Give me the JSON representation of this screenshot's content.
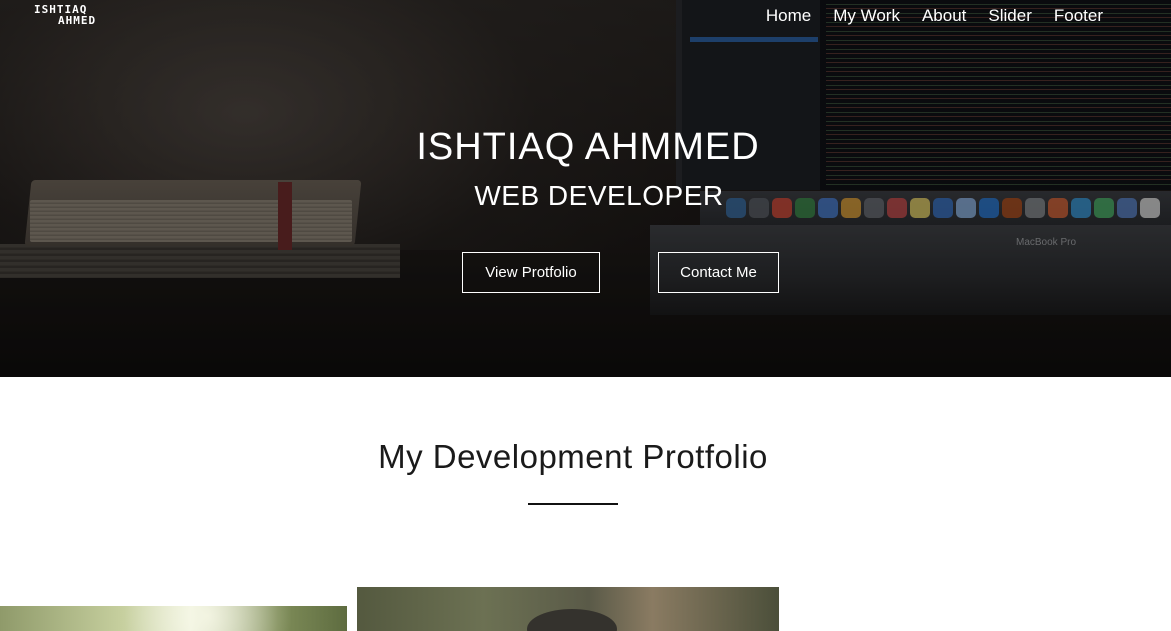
{
  "logo": {
    "line1": "ISHTIAQ",
    "line2": "AHMED"
  },
  "nav": {
    "items": [
      {
        "label": "Home"
      },
      {
        "label": "My Work"
      },
      {
        "label": "About"
      },
      {
        "label": "Slider"
      },
      {
        "label": "Footer"
      }
    ]
  },
  "hero": {
    "title": "ISHTIAQ AHMMED",
    "subtitle": "WEB DEVELOPER",
    "primary_button": "View Protfolio",
    "secondary_button": "Contact Me",
    "laptop_label": "MacBook Pro"
  },
  "portfolio": {
    "title": "My Development Protfolio"
  },
  "colors": {
    "accent_rule": "#111111",
    "hero_text": "#ffffff",
    "dock_icons": [
      "#3a6ea5",
      "#5a5f66",
      "#d44b3a",
      "#3c8c4b",
      "#4a7fd1",
      "#e0a23a",
      "#6b6f76",
      "#c94e4e",
      "#e8d46a",
      "#3a73c6",
      "#8fb6e6",
      "#2c7ad6",
      "#b0501e",
      "#8a8d92",
      "#d8663a",
      "#3a9ad9",
      "#4cb36a",
      "#5b84c8",
      "#e0e0e0"
    ]
  }
}
